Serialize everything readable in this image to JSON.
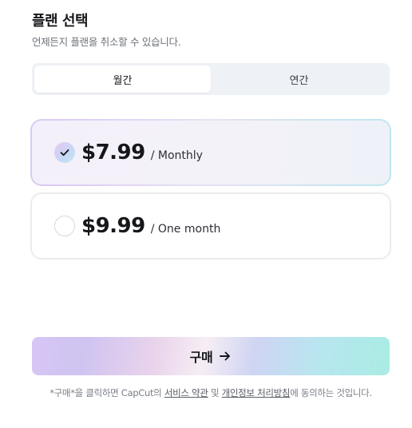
{
  "header": {
    "title": "플랜 선택",
    "subtitle": "언제든지 플랜을 취소할 수 있습니다."
  },
  "billing_toggle": {
    "tabs": [
      {
        "label": "월간",
        "active": true
      },
      {
        "label": "연간",
        "active": false
      }
    ]
  },
  "plans": [
    {
      "price": "$7.99",
      "period": "/ Monthly",
      "selected": true
    },
    {
      "price": "$9.99",
      "period": "/ One month",
      "selected": false
    }
  ],
  "purchase": {
    "label": "구매",
    "arrow_icon": "arrow-right-icon"
  },
  "terms": {
    "prefix": "*구매*을 클릭하면 CapCut의 ",
    "link_tos": "서비스 약관",
    "middle": " 및 ",
    "link_privacy": "개인정보 처리방침",
    "suffix": "에 동의하는 것입니다."
  },
  "colors": {
    "text_primary": "#16171a",
    "text_secondary": "#6b7078",
    "segment_bg": "#eef1f5",
    "selected_card_bg": "#f3f2f8"
  }
}
